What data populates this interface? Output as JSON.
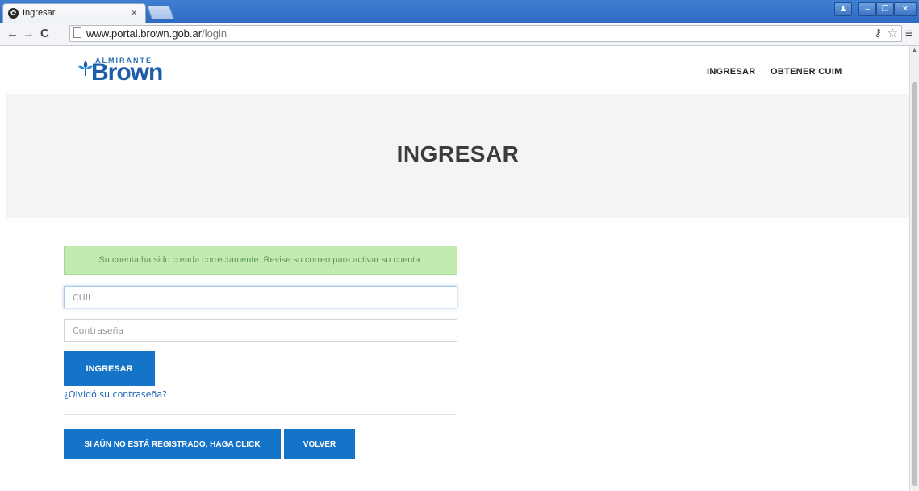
{
  "browser": {
    "tab_title": "Ingresar",
    "tab_close": "×",
    "url_host": "www.portal.brown.gob.ar",
    "url_path": "/login",
    "icons": {
      "favicon": "site-favicon",
      "back": "back-arrow-icon",
      "forward": "forward-arrow-icon",
      "reload": "reload-icon",
      "page": "page-icon",
      "key": "key-icon",
      "star": "bookmark-star-icon",
      "menu": "hamburger-menu-icon"
    }
  },
  "header": {
    "logo_small": "ALMIRANTE",
    "logo_big": "Brown",
    "nav": [
      "INGRESAR",
      "OBTENER CUIM"
    ],
    "brand_color": "#1c5ea8"
  },
  "hero": {
    "title": "INGRESAR"
  },
  "form": {
    "alert": "Su cuenta ha sido creada correctamente. Revise su correo para activar su cuenta.",
    "cuil_placeholder": "CUIL",
    "cuil_value": "",
    "password_placeholder": "Contraseña",
    "password_value": "",
    "submit_label": "INGRESAR",
    "forgot_label": "¿Olvidó su contraseña?",
    "register_label": "SI AÚN NO ESTÁ REGISTRADO, HAGA CLICK",
    "back_label": "VOLVER",
    "button_color": "#1674c8",
    "alert_color": "#c3eab0"
  }
}
